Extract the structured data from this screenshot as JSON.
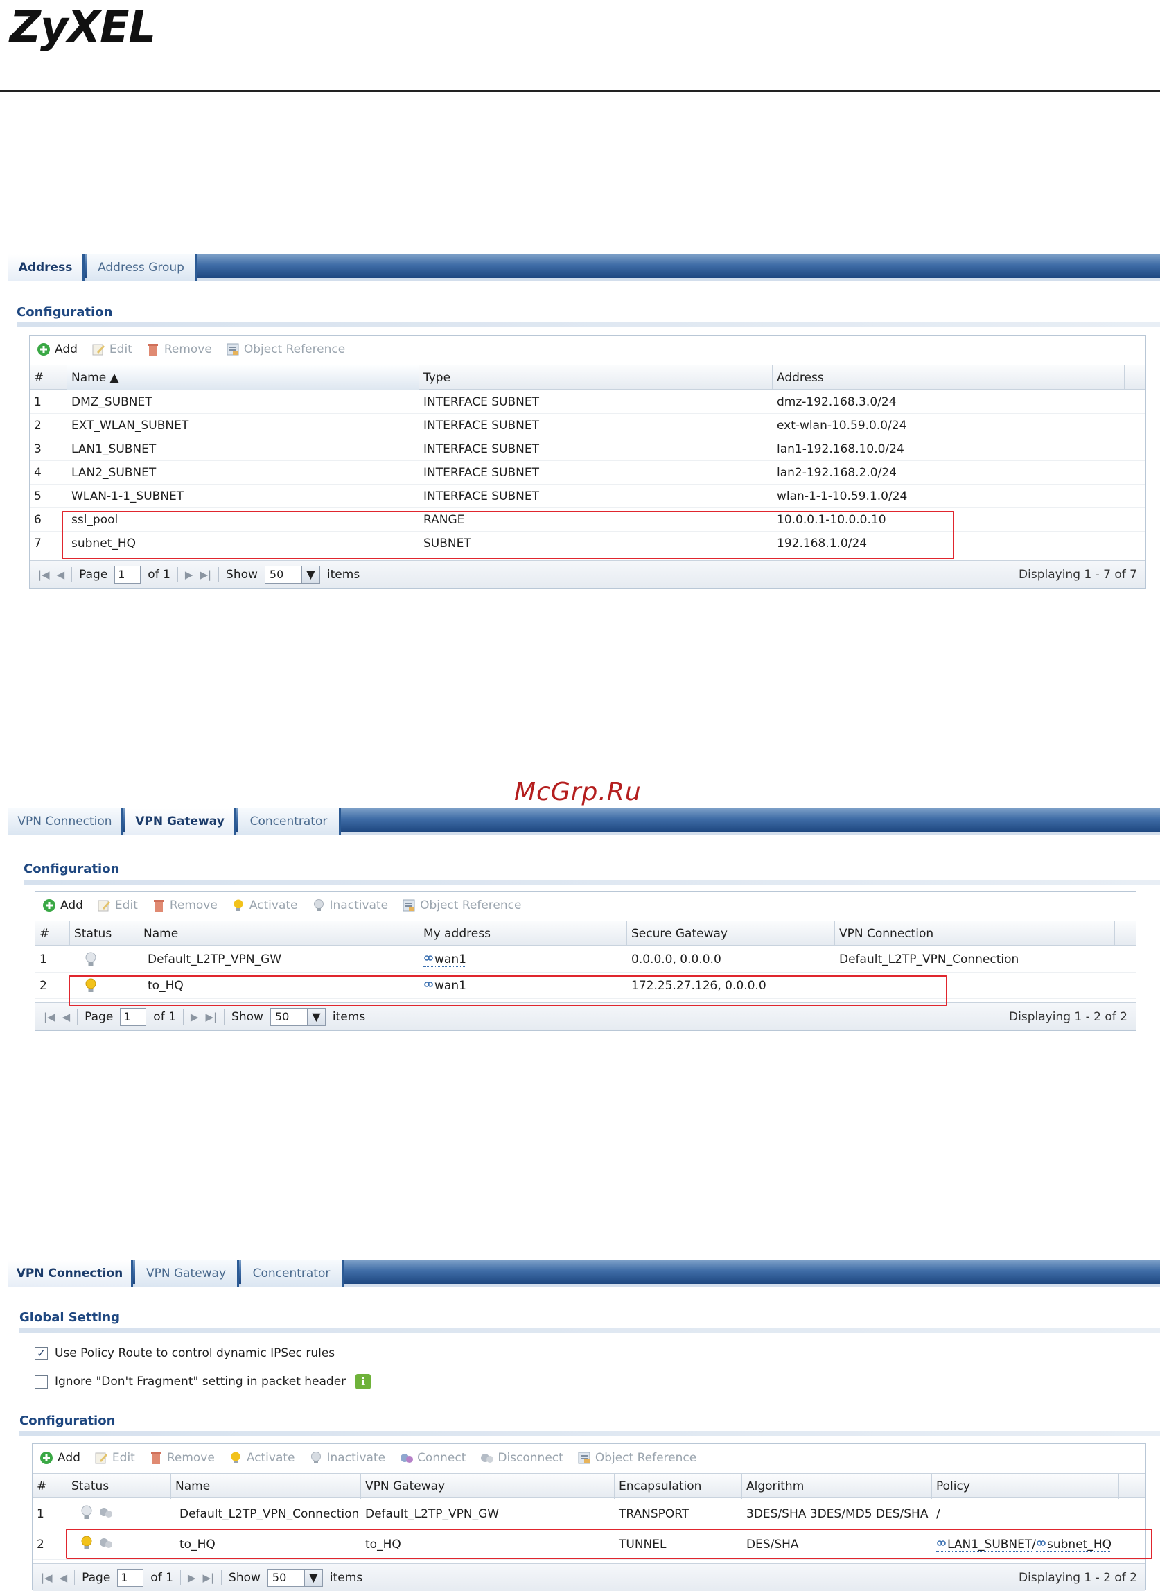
{
  "header": {
    "logo": "ZyXEL",
    "watermark": "McGrp.Ru"
  },
  "address_screen": {
    "tabs": [
      {
        "label": "Address",
        "active": true
      },
      {
        "label": "Address Group",
        "active": false
      }
    ],
    "section_title": "Configuration",
    "toolbar": {
      "add": "Add",
      "edit": "Edit",
      "remove": "Remove",
      "object_reference": "Object Reference"
    },
    "columns": [
      "#",
      "Name ▲",
      "Type",
      "Address"
    ],
    "rows": [
      {
        "num": "1",
        "name": "DMZ_SUBNET",
        "type": "INTERFACE SUBNET",
        "address": "dmz-192.168.3.0/24"
      },
      {
        "num": "2",
        "name": "EXT_WLAN_SUBNET",
        "type": "INTERFACE SUBNET",
        "address": "ext-wlan-10.59.0.0/24"
      },
      {
        "num": "3",
        "name": "LAN1_SUBNET",
        "type": "INTERFACE SUBNET",
        "address": "lan1-192.168.10.0/24"
      },
      {
        "num": "4",
        "name": "LAN2_SUBNET",
        "type": "INTERFACE SUBNET",
        "address": "lan2-192.168.2.0/24"
      },
      {
        "num": "5",
        "name": "WLAN-1-1_SUBNET",
        "type": "INTERFACE SUBNET",
        "address": "wlan-1-1-10.59.1.0/24"
      },
      {
        "num": "6",
        "name": "ssl_pool",
        "type": "RANGE",
        "address": "10.0.0.1-10.0.0.10"
      },
      {
        "num": "7",
        "name": "subnet_HQ",
        "type": "SUBNET",
        "address": "192.168.1.0/24"
      }
    ],
    "pager": {
      "page_label": "Page",
      "page_value": "1",
      "of": "of 1",
      "show": "Show",
      "show_value": "50",
      "items": "items",
      "display": "Displaying 1 - 7 of 7"
    }
  },
  "gateway_screen": {
    "tabs": [
      {
        "label": "VPN Connection",
        "active": false
      },
      {
        "label": "VPN Gateway",
        "active": true
      },
      {
        "label": "Concentrator",
        "active": false
      }
    ],
    "section_title": "Configuration",
    "toolbar": {
      "add": "Add",
      "edit": "Edit",
      "remove": "Remove",
      "activate": "Activate",
      "inactivate": "Inactivate",
      "object_reference": "Object Reference"
    },
    "columns": [
      "#",
      "Status",
      "Name",
      "My address",
      "Secure Gateway",
      "VPN Connection"
    ],
    "rows": [
      {
        "num": "1",
        "active": false,
        "name": "Default_L2TP_VPN_GW",
        "my_address": "wan1",
        "secure_gateway": "0.0.0.0, 0.0.0.0",
        "vpn_connection": "Default_L2TP_VPN_Connection"
      },
      {
        "num": "2",
        "active": true,
        "name": "to_HQ",
        "my_address": "wan1",
        "secure_gateway": "172.25.27.126, 0.0.0.0",
        "vpn_connection": ""
      }
    ],
    "pager": {
      "page_label": "Page",
      "page_value": "1",
      "of": "of 1",
      "show": "Show",
      "show_value": "50",
      "items": "items",
      "display": "Displaying 1 - 2 of 2"
    }
  },
  "connection_screen": {
    "tabs": [
      {
        "label": "VPN Connection",
        "active": true
      },
      {
        "label": "VPN Gateway",
        "active": false
      },
      {
        "label": "Concentrator",
        "active": false
      }
    ],
    "global_title": "Global Setting",
    "options": [
      {
        "label": "Use Policy Route to control dynamic IPSec rules",
        "checked": true
      },
      {
        "label": "Ignore \"Don't Fragment\" setting in packet header",
        "checked": false
      }
    ],
    "section_title": "Configuration",
    "toolbar": {
      "add": "Add",
      "edit": "Edit",
      "remove": "Remove",
      "activate": "Activate",
      "inactivate": "Inactivate",
      "connect": "Connect",
      "disconnect": "Disconnect",
      "object_reference": "Object Reference"
    },
    "columns": [
      "#",
      "Status",
      "Name",
      "VPN Gateway",
      "Encapsulation",
      "Algorithm",
      "Policy"
    ],
    "rows": [
      {
        "num": "1",
        "active": false,
        "name": "Default_L2TP_VPN_Connection",
        "gateway": "Default_L2TP_VPN_GW",
        "encapsulation": "TRANSPORT",
        "algorithm": "3DES/SHA 3DES/MD5 DES/SHA",
        "policy_local": "",
        "policy_sep": "/",
        "policy_remote": ""
      },
      {
        "num": "2",
        "active": true,
        "name": "to_HQ",
        "gateway": "to_HQ",
        "encapsulation": "TUNNEL",
        "algorithm": "DES/SHA",
        "policy_local": "LAN1_SUBNET",
        "policy_sep": "/",
        "policy_remote": "subnet_HQ"
      }
    ],
    "pager": {
      "page_label": "Page",
      "page_value": "1",
      "of": "of 1",
      "show": "Show",
      "show_value": "50",
      "items": "items",
      "display": "Displaying 1 - 2 of 2"
    }
  },
  "colors": {
    "tab_blue": "#1e4780",
    "section_title": "#1e4780",
    "highlight_red": "#e0262e",
    "bulb_on": "#f2c21b",
    "bulb_off": "#b8bec6",
    "add_green": "#3aa845"
  }
}
